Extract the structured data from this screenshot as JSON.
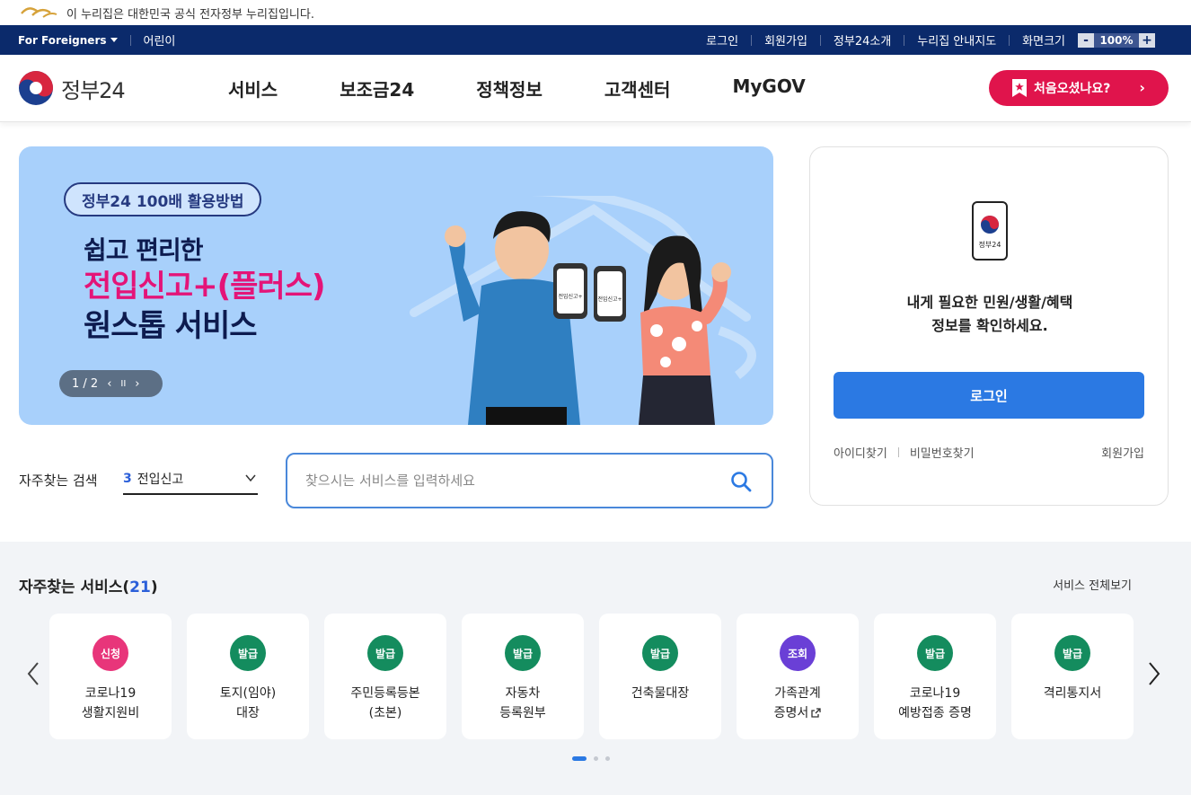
{
  "gov_banner": {
    "text": "이 누리집은 대한민국 공식 전자정부 누리집입니다."
  },
  "util": {
    "for_foreigners": "For Foreigners",
    "kids": "어린이",
    "links": [
      "로그인",
      "회원가입",
      "정부24소개",
      "누리집 안내지도"
    ],
    "zoom_label": "화면크기",
    "zoom_minus": "-",
    "zoom_value": "100%",
    "zoom_plus": "+"
  },
  "header": {
    "logo_text": "정부24",
    "nav": [
      "서비스",
      "보조금24",
      "정책정보",
      "고객센터",
      "MyGOV"
    ],
    "first_visit": "처음오셨나요?",
    "first_visit_chevron": "›"
  },
  "hero": {
    "pill": "정부24 100배 활용방법",
    "line1": "쉽고 편리한",
    "line2": "전입신고+(플러스)",
    "line3": "원스톱 서비스",
    "pager": "1 / 2",
    "prev": "‹",
    "pause": "II",
    "next": "›",
    "phone_label": "전입신고+",
    "colors": {
      "bg": "#a8d0fb",
      "accent": "#e41478",
      "navy": "#0d1b4f"
    }
  },
  "login": {
    "app_label": "정부24",
    "message_line1": "내게 필요한 민원/생활/혜택",
    "message_line2": "정보를 확인하세요.",
    "button": "로그인",
    "find_id": "아이디찾기",
    "find_pw": "비밀번호찾기",
    "join": "회원가입"
  },
  "search": {
    "fav_label": "자주찾는 검색",
    "fav_rank": "3",
    "fav_keyword": "전입신고",
    "placeholder": "찾으시는 서비스를 입력하세요"
  },
  "services": {
    "title": "자주찾는 서비스(",
    "count": "21",
    "title_end": ")",
    "view_all": "서비스 전체보기",
    "items": [
      {
        "badge": "신청",
        "color": "#e8357a",
        "name": "코로나19\n생활지원비"
      },
      {
        "badge": "발급",
        "color": "#148c5e",
        "name": "토지(임야)\n대장"
      },
      {
        "badge": "발급",
        "color": "#148c5e",
        "name": "주민등록등본\n(초본)"
      },
      {
        "badge": "발급",
        "color": "#148c5e",
        "name": "자동차\n등록원부"
      },
      {
        "badge": "발급",
        "color": "#148c5e",
        "name": "건축물대장"
      },
      {
        "badge": "조회",
        "color": "#6a3fd6",
        "name": "가족관계\n증명서",
        "external": true
      },
      {
        "badge": "발급",
        "color": "#148c5e",
        "name": "코로나19\n예방접종 증명"
      },
      {
        "badge": "발급",
        "color": "#148c5e",
        "name": "격리통지서"
      }
    ]
  },
  "colors": {
    "navy_bar": "#0b2a6b",
    "brand_red": "#e0144c",
    "primary_blue": "#2b79e3"
  }
}
